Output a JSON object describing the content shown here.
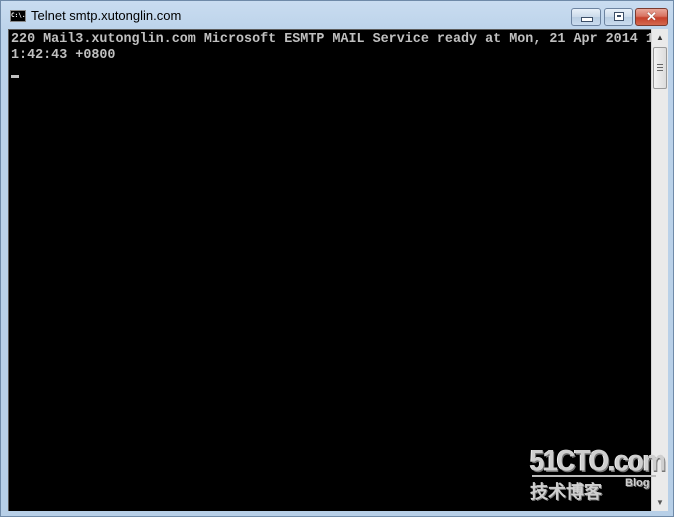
{
  "window": {
    "title": "Telnet smtp.xutonglin.com",
    "app_icon_text": "C:\\."
  },
  "caption_buttons": {
    "minimize": "minimize",
    "maximize": "maximize",
    "close": "✕"
  },
  "console": {
    "lines": [
      "220 Mail3.xutonglin.com Microsoft ESMTP MAIL Service ready at Mon, 21 Apr 2014 1",
      "1:42:43 +0800"
    ],
    "background": "#000000",
    "foreground": "#c0c0c0"
  },
  "scrollbar": {
    "up_arrow": "▲",
    "down_arrow": "▼"
  },
  "watermark": {
    "brand": "51CTO.com",
    "subtitle": "技术博客",
    "blog": "Blog"
  }
}
